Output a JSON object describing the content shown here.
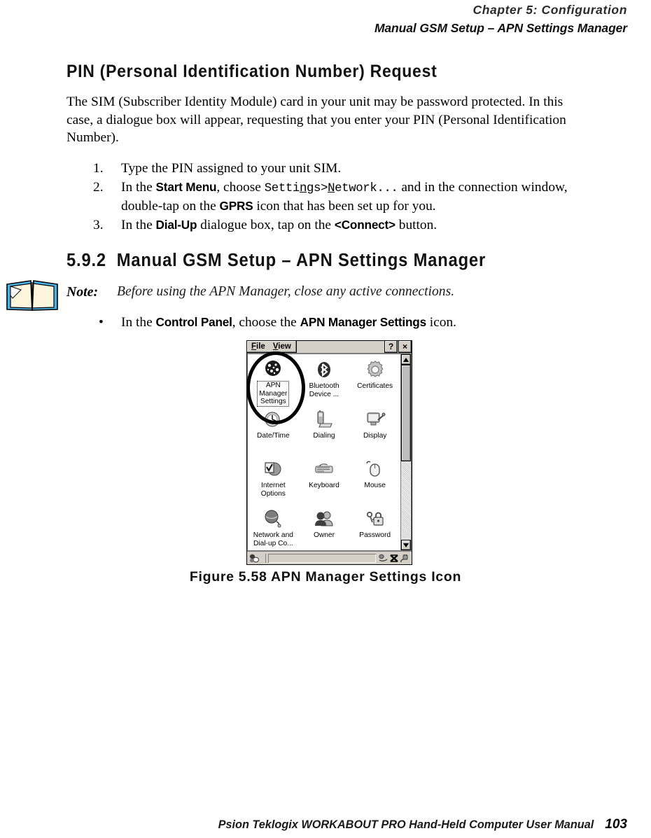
{
  "header": {
    "chapter": "Chapter 5: Configuration",
    "title": "Manual GSM Setup – APN Settings Manager"
  },
  "heading_pin": "PIN (Personal Identification Number) Request",
  "paragraph_1": "The SIM (Subscriber Identity Module) card in your unit may be password protected. In this case, a dialogue box will appear, requesting that you enter your PIN (Personal Identification Number).",
  "steps": [
    {
      "num": "1.",
      "parts": [
        {
          "t": "Type the PIN assigned to your unit SIM.",
          "style": "plain"
        }
      ]
    },
    {
      "num": "2.",
      "parts": [
        {
          "t": "In the ",
          "style": "plain"
        },
        {
          "t": "Start Menu",
          "style": "ui"
        },
        {
          "t": ", choose ",
          "style": "plain"
        },
        {
          "t": "Settings>Network...",
          "style": "mono"
        },
        {
          "t": " and in the connection window, double-tap on the ",
          "style": "plain"
        },
        {
          "t": "GPRS",
          "style": "ui"
        },
        {
          "t": " icon that has been set up for you.",
          "style": "plain"
        }
      ]
    },
    {
      "num": "3.",
      "parts": [
        {
          "t": "In the ",
          "style": "plain"
        },
        {
          "t": "Dial-Up",
          "style": "ui"
        },
        {
          "t": " dialogue box, tap on the ",
          "style": "plain"
        },
        {
          "t": "<Connect>",
          "style": "ui"
        },
        {
          "t": " button.",
          "style": "plain"
        }
      ]
    }
  ],
  "section": {
    "number": "5.9.2",
    "title": "Manual GSM Setup – APN Settings Manager"
  },
  "note": {
    "label": "Note:",
    "text": "Before using the APN Manager, close any active connections."
  },
  "bullet": {
    "marker": "•",
    "parts": [
      {
        "t": "In the ",
        "style": "plain"
      },
      {
        "t": "Control Panel",
        "style": "ui"
      },
      {
        "t": ", choose the ",
        "style": "plain"
      },
      {
        "t": "APN Manager Settings",
        "style": "ui"
      },
      {
        "t": " icon.",
        "style": "plain"
      }
    ]
  },
  "screenshot": {
    "menu": {
      "file": "File",
      "view": "View",
      "help_label": "?",
      "close_label": "×"
    },
    "icons": [
      {
        "label": "APN\nManager\nSettings",
        "icon": "apn-globe-icon",
        "selected": true
      },
      {
        "label": "Bluetooth\nDevice ...",
        "icon": "bluetooth-icon",
        "selected": false
      },
      {
        "label": "Certificates",
        "icon": "gear-icon",
        "selected": false
      },
      {
        "label": "Date/Time",
        "icon": "clock-icon",
        "selected": false
      },
      {
        "label": "Dialing",
        "icon": "phone-icon",
        "selected": false
      },
      {
        "label": "Display",
        "icon": "monitor-icon",
        "selected": false
      },
      {
        "label": "Internet\nOptions",
        "icon": "internet-shield-icon",
        "selected": false
      },
      {
        "label": "Keyboard",
        "icon": "keyboard-icon",
        "selected": false
      },
      {
        "label": "Mouse",
        "icon": "mouse-icon",
        "selected": false
      },
      {
        "label": "Network and\nDial-up Co...",
        "icon": "network-globe-icon",
        "selected": false
      },
      {
        "label": "Owner",
        "icon": "people-icon",
        "selected": false
      },
      {
        "label": "Password",
        "icon": "padlock-key-icon",
        "selected": false
      }
    ],
    "scrollbar": {
      "up": "▲",
      "down": "▼"
    }
  },
  "figure_caption": "Figure 5.58 APN Manager Settings Icon",
  "footer": {
    "text": "Psion Teklogix WORKABOUT PRO Hand-Held Computer User Manual",
    "page": "103"
  },
  "colors": {
    "window_face": "#d4d0c8",
    "ink": "#000000"
  }
}
